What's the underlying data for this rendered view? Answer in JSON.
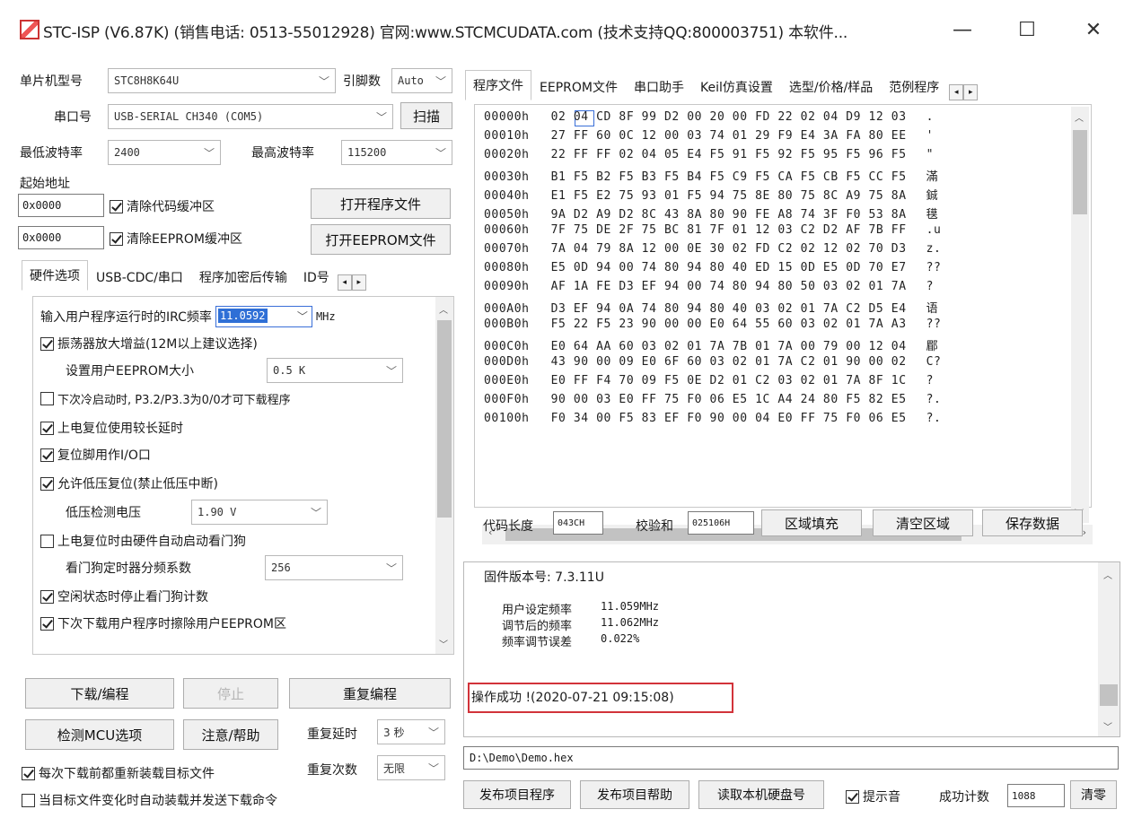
{
  "window": {
    "title": "STC-ISP (V6.87K) (销售电话: 0513-55012928) 官网:www.STCMCUDATA.com (技术支持QQ:800003751) 本软件...",
    "minimize": "—",
    "maximize": "☐",
    "close": "✕"
  },
  "left": {
    "mcu_label": "单片机型号",
    "mcu_value": "STC8H8K64U",
    "pin_label": "引脚数",
    "pin_value": "Auto",
    "port_label": "串口号",
    "port_value": "USB-SERIAL CH340 (COM5)",
    "scan_button": "扫描",
    "min_baud_label": "最低波特率",
    "min_baud_value": "2400",
    "max_baud_label": "最高波特率",
    "max_baud_value": "115200",
    "start_addr_label": "起始地址",
    "code_addr": "0x0000",
    "clear_code_label": "清除代码缓冲区",
    "open_prog_button": "打开程序文件",
    "eeprom_addr": "0x0000",
    "clear_eeprom_label": "清除EEPROM缓冲区",
    "open_eeprom_button": "打开EEPROM文件",
    "tabs": [
      "硬件选项",
      "USB-CDC/串口",
      "程序加密后传输",
      "ID号"
    ],
    "hw": {
      "irc_label": "输入用户程序运行时的IRC频率",
      "irc_value": "11.0592",
      "irc_unit": "MHz",
      "amp_label": "振荡器放大增益(12M以上建议选择)",
      "eeprom_size_label": "设置用户EEPROM大小",
      "eeprom_size_value": "0.5 K",
      "cold_start_label": "下次冷启动时, P3.2/P3.3为0/0才可下载程序",
      "long_reset_label": "上电复位使用较长延时",
      "reset_io_label": "复位脚用作I/O口",
      "lvd_label": "允许低压复位(禁止低压中断)",
      "lvd_volt_label": "低压检测电压",
      "lvd_volt_value": "1.90 V",
      "wdt_auto_label": "上电复位时由硬件自动启动看门狗",
      "wdt_div_label": "看门狗定时器分频系数",
      "wdt_div_value": "256",
      "wdt_idle_label": "空闲状态时停止看门狗计数",
      "erase_eeprom_label": "下次下载用户程序时擦除用户EEPROM区"
    },
    "download_button": "下载/编程",
    "stop_button": "停止",
    "reprogram_button": "重复编程",
    "check_mcu_button": "检测MCU选项",
    "help_button": "注意/帮助",
    "repeat_delay_label": "重复延时",
    "repeat_delay_value": "3 秒",
    "repeat_count_label": "重复次数",
    "repeat_count_value": "无限",
    "reload_label": "每次下载前都重新装载目标文件",
    "auto_send_label": "当目标文件变化时自动装载并发送下载命令"
  },
  "right": {
    "tabs": [
      "程序文件",
      "EEPROM文件",
      "串口助手",
      "Keil仿真设置",
      "选型/价格/样品",
      "范例程序"
    ],
    "hex_rows": [
      {
        "addr": "00000h",
        "bytes": "02 04 CD 8F 99 D2 00 20 00 FD 22 02 04 D9 12 03",
        "ascii": "."
      },
      {
        "addr": "00010h",
        "bytes": "27 FF 60 0C 12 00 03 74 01 29 F9 E4 3A FA 80 EE",
        "ascii": "'"
      },
      {
        "addr": "00020h",
        "bytes": "22 FF FF 02 04 05 E4 F5 91 F5 92 F5 95 F5 96 F5",
        "ascii": "\""
      },
      {
        "addr": "00030h",
        "bytes": "B1 F5 B2 F5 B3 F5 B4 F5 C9 F5 CA F5 CB F5 CC F5",
        "ascii": "滿"
      },
      {
        "addr": "00040h",
        "bytes": "E1 F5 E2 75 93 01 F5 94 75 8E 80 75 8C A9 75 8A",
        "ascii": "鋮"
      },
      {
        "addr": "00050h",
        "bytes": "9A D2 A9 D2 8C 43 8A 80 90 FE A8 74 3F F0 53 8A",
        "ascii": "氁"
      },
      {
        "addr": "00060h",
        "bytes": "7F 75 DE 2F 75 BC 81 7F 01 12 03 C2 D2 AF 7B FF",
        "ascii": ".u"
      },
      {
        "addr": "00070h",
        "bytes": "7A 04 79 8A 12 00 0E 30 02 FD C2 02 12 02 70 D3",
        "ascii": "z."
      },
      {
        "addr": "00080h",
        "bytes": "E5 0D 94 00 74 80 94 80 40 ED 15 0D E5 0D 70 E7",
        "ascii": "??"
      },
      {
        "addr": "00090h",
        "bytes": "AF 1A FE D3 EF 94 00 74 80 94 80 50 03 02 01 7A",
        "ascii": "?"
      },
      {
        "addr": "000A0h",
        "bytes": "D3 EF 94 0A 74 80 94 80 40 03 02 01 7A C2 D5 E4",
        "ascii": "语"
      },
      {
        "addr": "000B0h",
        "bytes": "F5 22 F5 23 90 00 00 E0 64 55 60 03 02 01 7A A3",
        "ascii": "??"
      },
      {
        "addr": "000C0h",
        "bytes": "E0 64 AA 60 03 02 01 7A 7B 01 7A 00 79 00 12 04",
        "ascii": "郿"
      },
      {
        "addr": "000D0h",
        "bytes": "43 90 00 09 E0 6F 60 03 02 01 7A C2 01 90 00 02",
        "ascii": "C?"
      },
      {
        "addr": "000E0h",
        "bytes": "E0 FF F4 70 09 F5 0E D2 01 C2 03 02 01 7A 8F 1C",
        "ascii": "?"
      },
      {
        "addr": "000F0h",
        "bytes": "90 00 03 E0 FF 75 F0 06 E5 1C A4 24 80 F5 82 E5",
        "ascii": "?."
      },
      {
        "addr": "00100h",
        "bytes": "F0 34 00 F5 83 EF F0 90 00 04 E0 FF 75 F0 06 E5",
        "ascii": "?."
      }
    ],
    "code_len_label": "代码长度",
    "code_len_value": "043CH",
    "checksum_label": "校验和",
    "checksum_value": "025106H",
    "fill_button": "区域填充",
    "clear_button": "清空区域",
    "save_button": "保存数据",
    "log": {
      "firmware": "固件版本号: 7.3.11U",
      "user_freq_label": "用户设定频率",
      "user_freq_value": "11.059MHz",
      "adj_freq_label": "调节后的频率",
      "adj_freq_value": "11.062MHz",
      "err_label": "频率调节误差",
      "err_value": "0.022%",
      "success": "操作成功 !(2020-07-21 09:15:08)"
    },
    "path": "D:\\Demo\\Demo.hex",
    "publish_button": "发布项目程序",
    "publish_help_button": "发布项目帮助",
    "read_disk_button": "读取本机硬盘号",
    "beep_label": "提示音",
    "success_count_label": "成功计数",
    "success_count_value": "1088",
    "clear_count_button": "清零"
  }
}
